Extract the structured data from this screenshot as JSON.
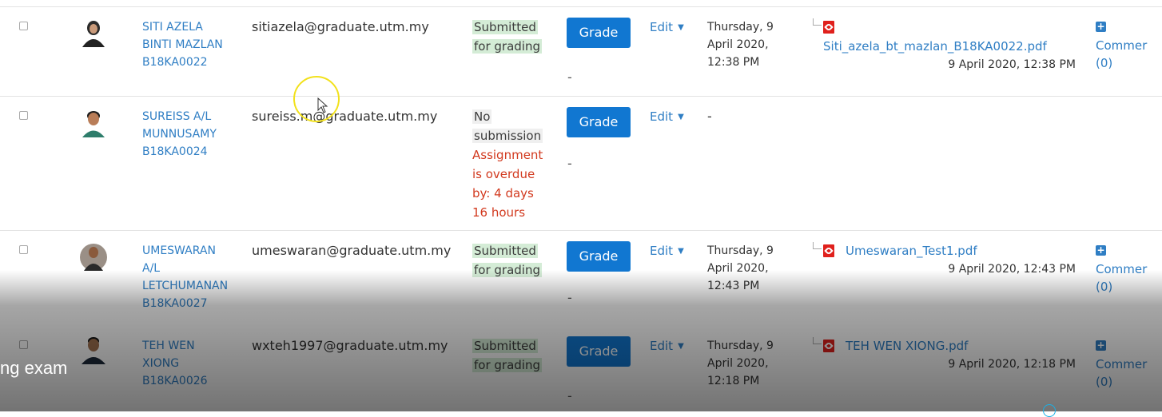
{
  "rows": [
    {
      "name": [
        "SITI AZELA",
        "BINTI MAZLAN",
        "B18KA0022"
      ],
      "email": "sitiazela@graduate.utm.my",
      "status": [
        "Submitted",
        "for grading"
      ],
      "grade_label": "Grade",
      "grade_dash": "-",
      "edit_label": "Edit",
      "modified": [
        "Thursday, 9",
        "April 2020,",
        "12:38 PM"
      ],
      "file_name": "Siti_azela_bt_mazlan_B18KA0022.pdf",
      "file_date": "9 April 2020, 12:38 PM",
      "comments": [
        "Commer",
        "(0)"
      ]
    },
    {
      "name": [
        "SUREISS A/L",
        "MUNNUSAMY",
        "B18KA0024"
      ],
      "email": "sureiss.m@graduate.utm.my",
      "status": [
        "No",
        "submission"
      ],
      "overdue": [
        "Assignment",
        "is overdue",
        "by: 4 days",
        "16 hours"
      ],
      "grade_label": "Grade",
      "grade_dash": "-",
      "edit_label": "Edit",
      "modified_dash": "-"
    },
    {
      "name": [
        "UMESWARAN",
        "A/L",
        "LETCHUMANAN",
        "B18KA0027"
      ],
      "email": "umeswaran@graduate.utm.my",
      "status": [
        "Submitted",
        "for grading"
      ],
      "grade_label": "Grade",
      "grade_dash": "-",
      "edit_label": "Edit",
      "modified": [
        "Thursday, 9",
        "April 2020,",
        "12:43 PM"
      ],
      "file_name": "Umeswaran_Test1.pdf",
      "file_date": "9 April 2020, 12:43 PM",
      "comments": [
        "Commer",
        "(0)"
      ]
    },
    {
      "name": [
        "TEH WEN",
        "XIONG",
        "B18KA0026"
      ],
      "email": "wxteh1997@graduate.utm.my",
      "status": [
        "Submitted",
        "for grading"
      ],
      "grade_label": "Grade",
      "grade_dash": "-",
      "edit_label": "Edit",
      "modified": [
        "Thursday, 9",
        "April 2020,",
        "12:18 PM"
      ],
      "file_name": "TEH WEN XIONG.pdf",
      "file_date": "9 April 2020, 12:18 PM",
      "comments": [
        "Commer",
        "(0)"
      ]
    }
  ],
  "icons": {
    "pdf": "pdf-file-icon",
    "plus": "plus-square-icon",
    "caret": "caret-down-icon"
  },
  "colors": {
    "link": "#2f7ec4",
    "grade_button": "#1177d1",
    "submitted_bg": "#d4ecd6",
    "overdue": "#d23a1f"
  },
  "caption": "ng exam"
}
